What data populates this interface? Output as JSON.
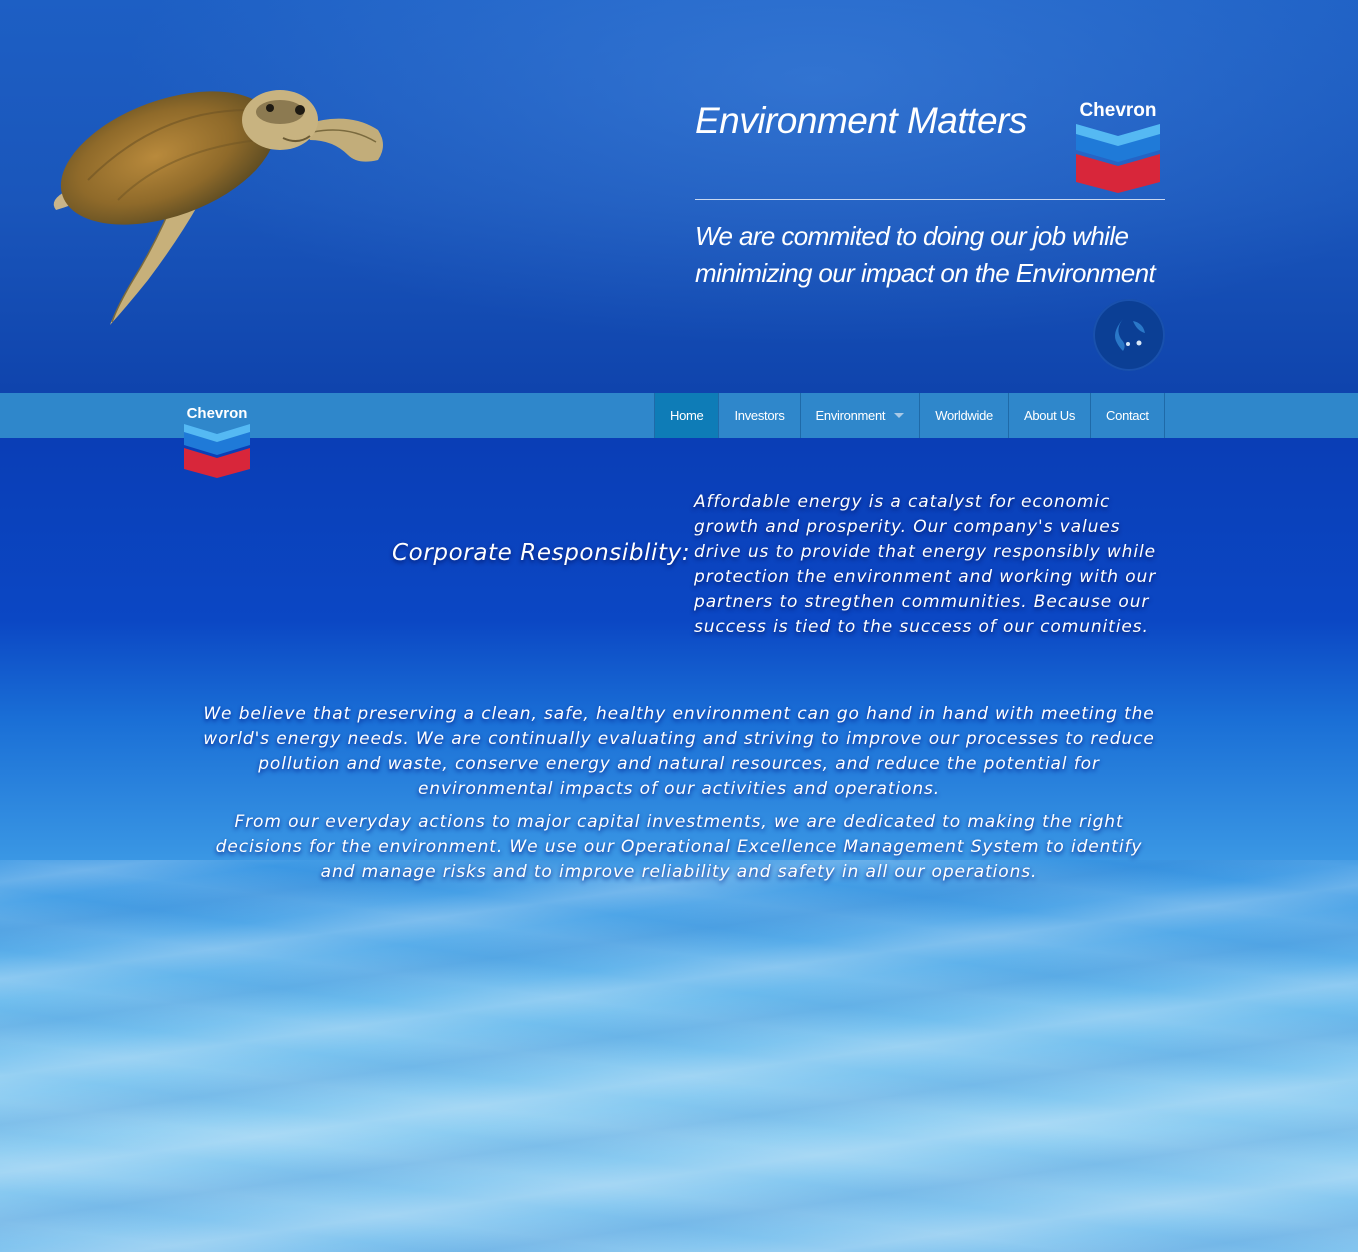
{
  "hero": {
    "title": "Environment Matters",
    "subtitle": "We are commited to doing our job while minimizing our impact on the Environment"
  },
  "brand": {
    "name": "Chevron",
    "colors": {
      "blue_top": "#4fb3f0",
      "blue_mid": "#1d6fd0",
      "red": "#d8263a"
    }
  },
  "nav": {
    "items": [
      {
        "label": "Home",
        "active": true
      },
      {
        "label": "Investors"
      },
      {
        "label": "Environment",
        "has_dropdown": true
      },
      {
        "label": "Worldwide"
      },
      {
        "label": "About Us"
      },
      {
        "label": "Contact"
      }
    ]
  },
  "main": {
    "section_label": "Corporate Responsiblity:",
    "section_text": "Affordable energy is a catalyst for economic growth and prosperity. Our company's values drive us to provide that energy responsibly while protection the environment and working with our partners to stregthen communities. Because our success is tied to the success of our comunities.",
    "paragraph1": "We believe that preserving a clean, safe, healthy environment can go hand in hand with meeting the world's energy needs. We are continually evaluating and striving to improve our processes to reduce pollution and waste, conserve energy and natural resources, and reduce the potential for environmental impacts of our activities and operations.",
    "paragraph2": "From our everyday actions to major capital investments, we are dedicated to making the right decisions for the environment. We use our Operational Excellence Management System to identify and manage risks and to improve reliability and safety in all our operations."
  },
  "icons": [
    "sea-turtle-image",
    "chevron-logo",
    "globe-icon",
    "dropdown-caret-icon"
  ]
}
